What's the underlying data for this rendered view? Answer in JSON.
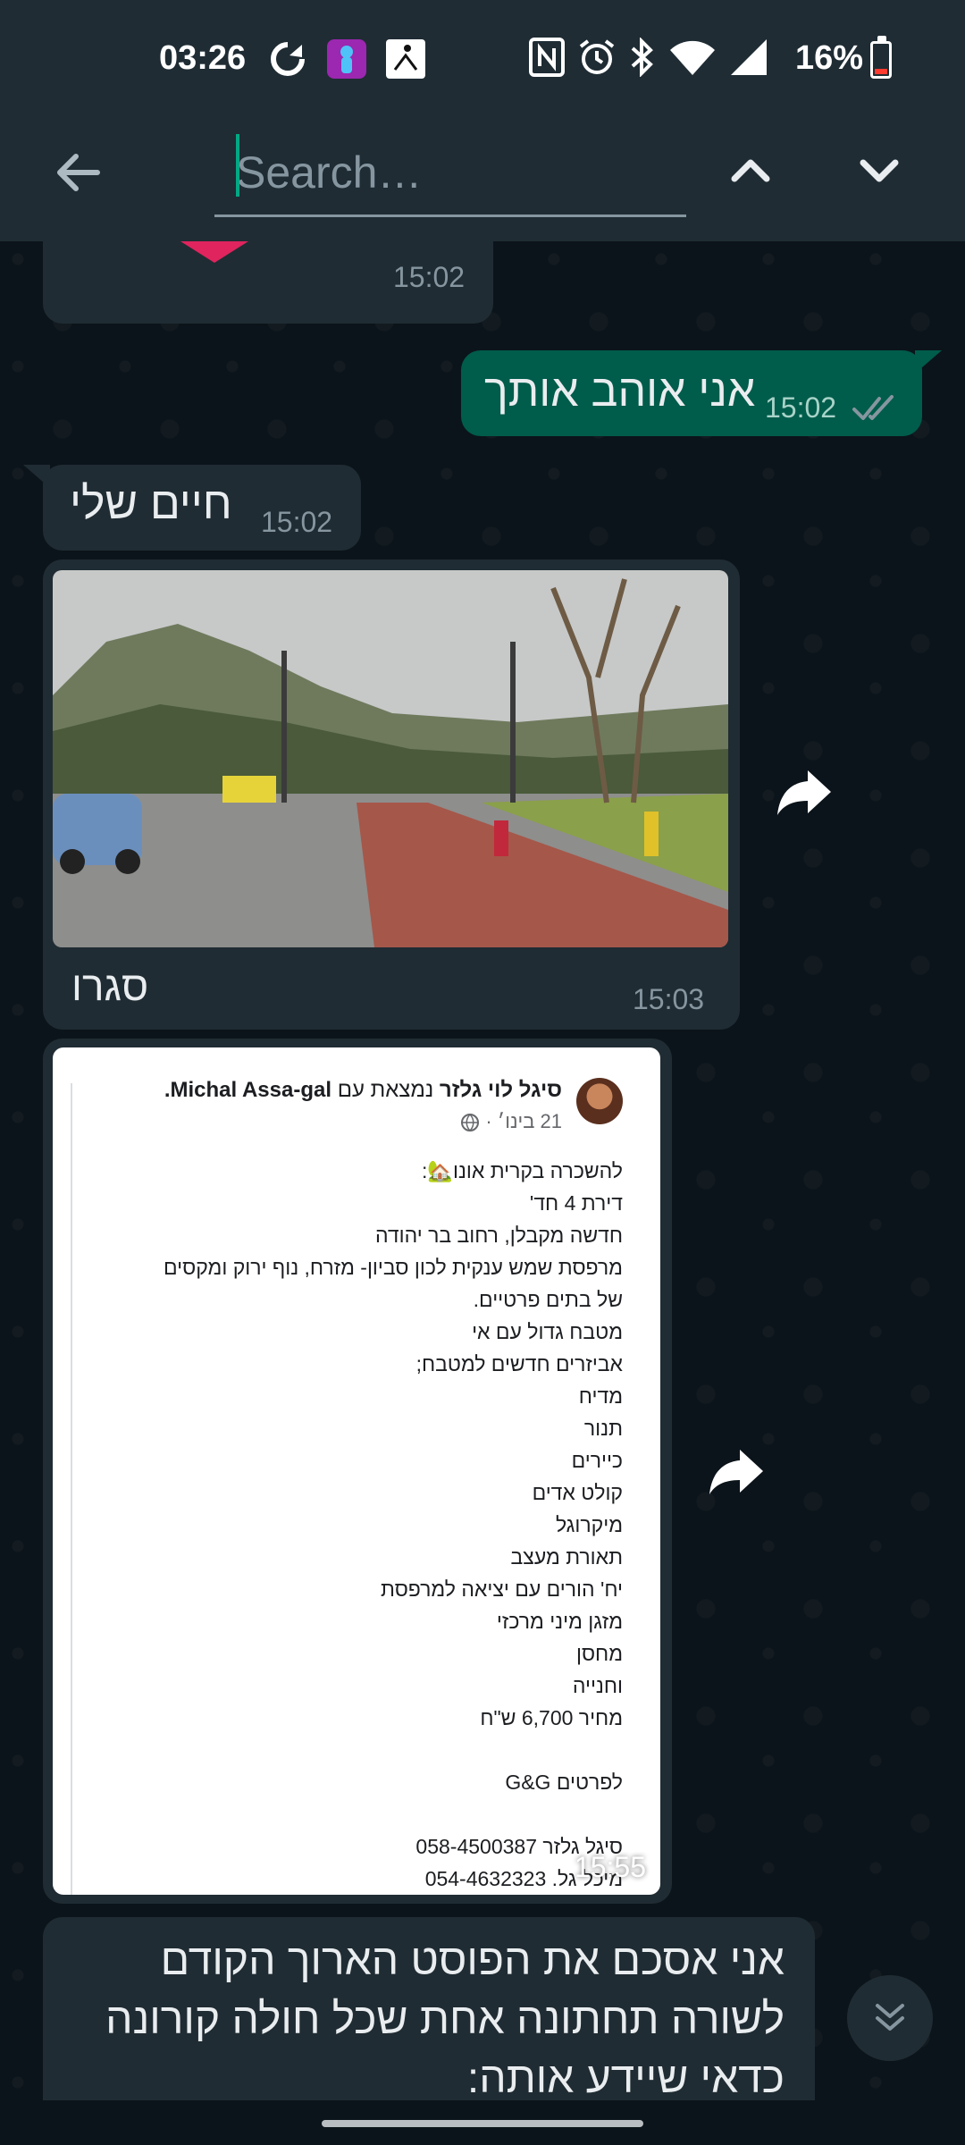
{
  "status_bar": {
    "time": "03:26",
    "battery": "16%",
    "battery_level": 0.16,
    "icons": [
      "sync-icon",
      "app-icon",
      "figure-icon",
      "nfc-icon",
      "alarm-icon",
      "bluetooth-icon",
      "wifi-icon",
      "signal-icon",
      "battery-icon"
    ]
  },
  "toolbar": {
    "search_placeholder": "Search…",
    "back_icon": "arrow-left-icon",
    "up_icon": "chevron-up-icon",
    "down_icon": "chevron-down-icon"
  },
  "messages": {
    "m0": {
      "time": "15:02"
    },
    "m1": {
      "text": "אני אוהב אותך",
      "time": "15:02",
      "status": "read"
    },
    "m2": {
      "text": "חיים שלי",
      "time": "15:02"
    },
    "m3": {
      "caption": "סגרו",
      "time": "15:03"
    },
    "m4": {
      "time": "15:55",
      "post": {
        "author": "סיגל לוי גלזר",
        "with_text": "נמצאת עם",
        "tagged": "Michal Assa-gal.",
        "date": "21 בינו׳ ·",
        "lines": [
          "להשכרה בקרית אונו🏡:",
          "דירת 4 חד'",
          "חדשה מקבלן, רחוב בר יהודה",
          "מרפסת שמש ענקית לכון סביון- מזרח, נוף ירוק ומקסים",
          "של בתים פרטיים.",
          "מטבח גדול עם אי",
          "אביזרים חדשים למטבח;",
          "מדיח",
          "תנור",
          "כיירים",
          "קולט אדים",
          "מיקרוגל",
          "תאורת מעצב",
          "יח' הורים עם יציאה למרפסת",
          "מזגן מיני מרכזי",
          "מחסן",
          "וחנייה",
          "מחיר 6,700 ש\"ח",
          "",
          "לפרטים G&G",
          "",
          "סיגל גלזר 058-4500387",
          "מיכל גל. 054-4632323"
        ]
      }
    },
    "m5": {
      "lines": [
        "אני אסכם את הפוסט הארוך הקודם",
        "לשורה תחתונה אחת שכל חולה קורונה",
        "כדאי שיידע אותה:"
      ]
    }
  }
}
